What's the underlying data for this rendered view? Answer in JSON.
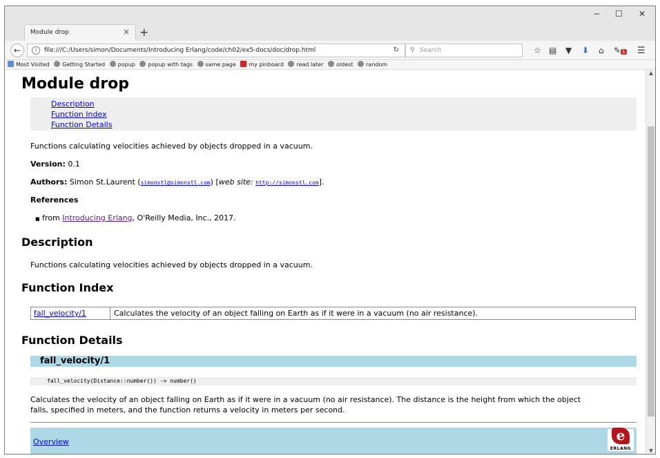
{
  "browser": {
    "tab_title": "Module drop",
    "tab_close": "×",
    "new_tab": "+",
    "minimize": "−",
    "maximize": "☐",
    "close": "✕",
    "url": "file:///C:/Users/simon/Documents/Introducing Erlang/code/ch02/ex5-docs/doc/drop.html",
    "search_placeholder": "Search",
    "bookmarks": [
      "Most Visited",
      "Getting Started",
      "popup",
      "popup with tags",
      "same page",
      "my pinboard",
      "read later",
      "oldest",
      "random"
    ],
    "icons": [
      "back-arrow-icon",
      "info-icon",
      "reload-icon",
      "search-icon",
      "star-icon",
      "reading-list-icon",
      "pocket-icon",
      "download-icon",
      "home-icon",
      "addon-icon",
      "menu-icon"
    ],
    "addon_badge": "1"
  },
  "doc": {
    "title": "Module drop",
    "nav_links": [
      "Description",
      "Function Index",
      "Function Details"
    ],
    "summary": "Functions calculating velocities achieved by objects dropped in a vacuum.",
    "version_label": "Version:",
    "version": "0.1",
    "authors_label": "Authors:",
    "author_name": "Simon St.Laurent (",
    "author_email": "simonstl@simonstl.com",
    "author_mid": ") [",
    "web_site_label": "web site:",
    "web_site_url": "http://simonstl.com",
    "author_end": "].",
    "references_label": "References",
    "reference_prefix": "from ",
    "reference_link": "Introducing Erlang",
    "reference_suffix": ", O'Reilly Media, Inc., 2017.",
    "description_heading": "Description",
    "description_text": "Functions calculating velocities achieved by objects dropped in a vacuum.",
    "index_heading": "Function Index",
    "index_rows": [
      {
        "name": "fall_velocity/1",
        "desc": "Calculates the velocity of an object falling on Earth as if it were in a vacuum (no air resistance)."
      }
    ],
    "details_heading": "Function Details",
    "function_name": "fall_velocity/1",
    "signature": "fall_velocity(Distance::number()) -> number()",
    "function_desc_line1": "Calculates the velocity of an object falling on Earth as if it were in a vacuum (no air resistance). The distance is the height from which the object",
    "function_desc_line2": "falls, specified in meters, and the function returns a velocity in meters per second.",
    "footer_link": "Overview",
    "logo_letter": "e",
    "logo_word": "ERLANG"
  }
}
